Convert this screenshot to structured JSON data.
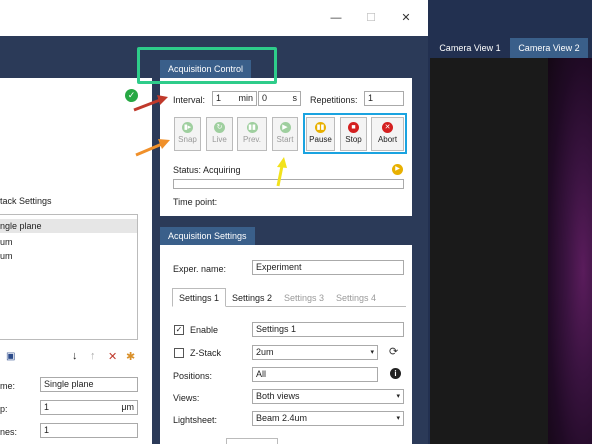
{
  "window": {
    "min": "—",
    "max": "☐",
    "close": "✕"
  },
  "left": {
    "check_icon": "check-circle-icon",
    "stack_settings": "tack Settings",
    "stack_list": [
      "ngle plane",
      "um",
      "um"
    ],
    "tools": {
      "save": "💾",
      "down": "↓",
      "up": "↑",
      "del": "✕",
      "star": "✱"
    },
    "name_label": "me:",
    "name_value": "Single plane",
    "step_label": "p:",
    "step_value": "1",
    "step_unit": "μm",
    "planes_label": "nes:",
    "planes_value": "1"
  },
  "acq_control": {
    "tab": "Acquisition Control",
    "interval_label": "Interval:",
    "interval_min": "1",
    "min_unit": "min",
    "interval_sec": "0",
    "sec_unit": "s",
    "repetitions_label": "Repetitions:",
    "repetitions": "1",
    "buttons": [
      {
        "label": "Snap",
        "icon": "▮▸",
        "color": "#9fcf9f"
      },
      {
        "label": "Live",
        "icon": "↻",
        "color": "#9fcf9f"
      },
      {
        "label": "Prev.",
        "icon": "▮▮",
        "color": "#9fcf9f"
      },
      {
        "label": "Start",
        "icon": "▶",
        "color": "#9fcf9f"
      },
      {
        "label": "Pause",
        "icon": "▮▮",
        "color": "#e8b000"
      },
      {
        "label": "Stop",
        "icon": "■",
        "color": "#d42020"
      },
      {
        "label": "Abort",
        "icon": "✕",
        "color": "#d42020"
      }
    ],
    "status_label": "Status: Acquiring",
    "timepoint_label": "Time point:"
  },
  "acq_settings": {
    "tab": "Acquisition Settings",
    "exper_label": "Exper. name:",
    "exper_value": "Experiment",
    "tabs": [
      "Settings 1",
      "Settings 2",
      "Settings 3",
      "Settings 4"
    ],
    "enable_label": "Enable",
    "enable_value": "Settings 1",
    "zstack_label": "Z-Stack",
    "zstack_value": "2um",
    "positions_label": "Positions:",
    "positions_value": "All",
    "views_label": "Views:",
    "views_value": "Both views",
    "lightsheet_label": "Lightsheet:",
    "lightsheet_value": "Beam 2.4um"
  },
  "camera": {
    "tabs": [
      "Camera View 1",
      "Camera View 2"
    ]
  },
  "colors": {
    "green": "#2ecc8a",
    "blue": "#1aa3e0",
    "yellow": "#f2e21c",
    "orange": "#f0902a",
    "red": "#c0392b"
  }
}
